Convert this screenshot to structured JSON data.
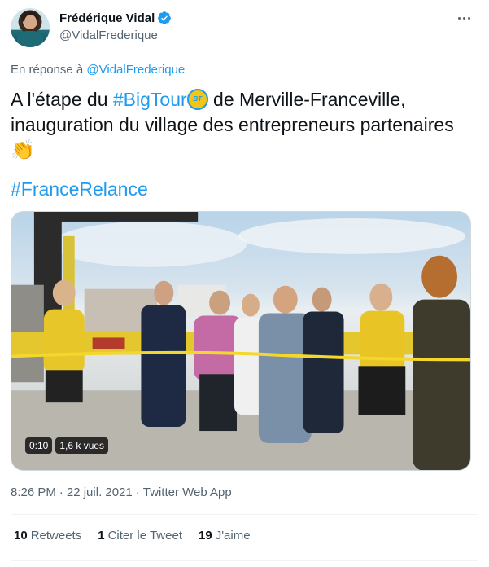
{
  "author": {
    "display_name": "Frédérique Vidal",
    "handle": "@VidalFrederique",
    "verified": true
  },
  "reply": {
    "prefix": "En réponse à",
    "handle": "@VidalFrederique"
  },
  "tweet": {
    "text_part1": "A l'étape du ",
    "hashtag1": "#BigTour",
    "emoji_label": "BIG TOUR",
    "text_part2": " de Merville-Franceville, inauguration du village des entrepreneurs partenaires",
    "hashtag2": "#FranceRelance"
  },
  "media": {
    "duration": "0:10",
    "views": "1,6 k vues"
  },
  "meta": {
    "time": "8:26 PM",
    "date": "22 juil. 2021",
    "source": "Twitter Web App"
  },
  "stats": {
    "retweets_count": "10",
    "retweets_label": "Retweets",
    "quotes_count": "1",
    "quotes_label": "Citer le Tweet",
    "likes_count": "19",
    "likes_label": "J'aime"
  },
  "colors": {
    "accent": "#1d9bf0",
    "text": "#0f1419",
    "secondary": "#536471"
  },
  "icons": [
    "verified-badge-icon",
    "more-options-icon",
    "clapping-hands-emoji",
    "big-tour-emoji"
  ]
}
